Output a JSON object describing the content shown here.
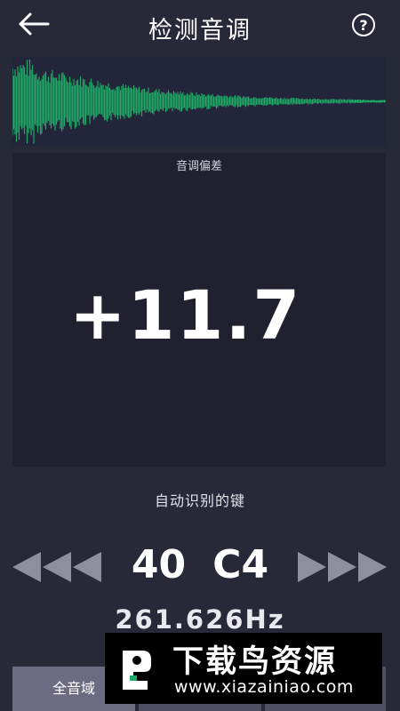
{
  "header": {
    "back_icon": "arrow-left-icon",
    "title": "检测音调",
    "help_icon": "question-circle-icon"
  },
  "waveform": {
    "color": "#1fa866"
  },
  "deviation": {
    "label": "音调偏差",
    "value": "+11.7"
  },
  "detection": {
    "label": "自动识别的键",
    "key_number": "40",
    "key_note": "C4",
    "frequency": "261.626Hz",
    "arrow_color": "#8e8e9c"
  },
  "tabs": [
    {
      "label": "全音域",
      "active": true
    },
    {
      "label": ""
    },
    {
      "label": ""
    }
  ],
  "watermark": {
    "title": "下载鸟资源",
    "url": "www.xiazainiao.com"
  }
}
